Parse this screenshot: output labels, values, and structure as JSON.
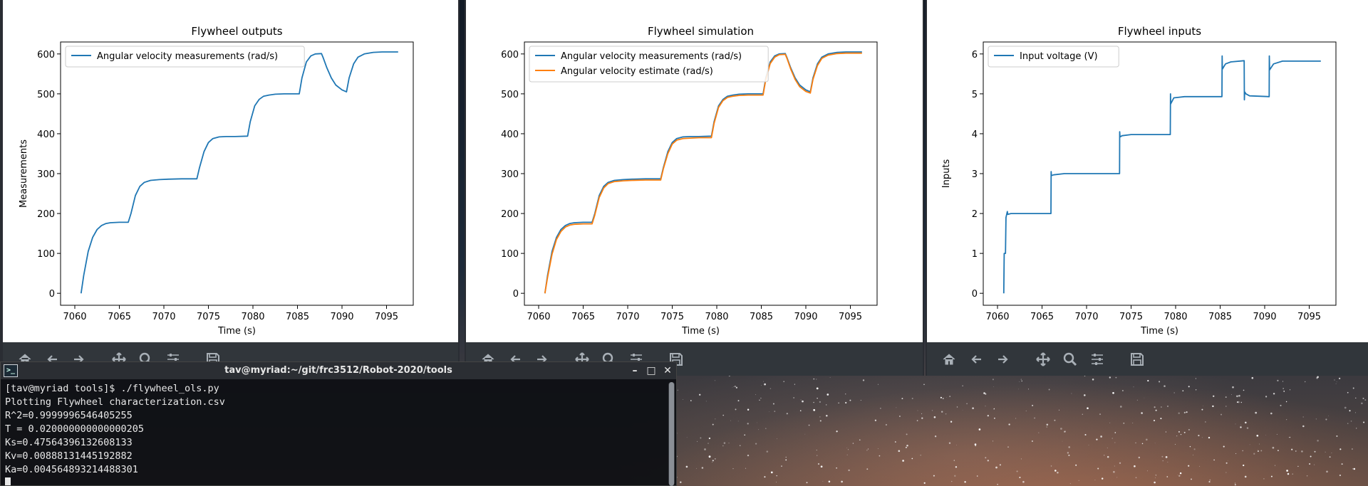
{
  "colors": {
    "series_blue": "#1f77b4",
    "series_orange": "#ff7f0e",
    "toolbar_bg": "#31363b",
    "toolbar_icon": "#a9b0b7",
    "terminal_text": "#e8e8e8"
  },
  "toolbar": {
    "icons": [
      "home-icon",
      "back-arrow-icon",
      "forward-arrow-icon",
      "pan-icon",
      "zoom-icon",
      "configure-subplots-icon",
      "save-icon"
    ]
  },
  "chart_data": [
    {
      "type": "line",
      "title": "Flywheel outputs",
      "xlabel": "Time (s)",
      "ylabel": "Measurements",
      "xlim": [
        7058.4,
        7098.0
      ],
      "ylim": [
        -30,
        630
      ],
      "xticks": [
        7060,
        7065,
        7070,
        7075,
        7080,
        7085,
        7090,
        7095
      ],
      "yticks": [
        0,
        100,
        200,
        300,
        400,
        500,
        600
      ],
      "legend": "top-left",
      "series": [
        {
          "name": "Angular velocity measurements (rad/s)",
          "color": "#1f77b4",
          "x": [
            7060.7,
            7061.0,
            7061.5,
            7062.0,
            7062.5,
            7063.0,
            7063.5,
            7064.0,
            7065.0,
            7066.0,
            7066.3,
            7066.8,
            7067.3,
            7067.8,
            7068.5,
            7069.5,
            7070.5,
            7072.0,
            7073.7,
            7074.0,
            7074.5,
            7075.0,
            7075.5,
            7076.2,
            7077.0,
            7078.0,
            7079.4,
            7079.7,
            7080.2,
            7080.7,
            7081.2,
            7081.8,
            7082.5,
            7083.5,
            7085.2,
            7085.5,
            7086.0,
            7086.5,
            7087.0,
            7087.7,
            7087.9,
            7088.3,
            7088.8,
            7089.3,
            7090.0,
            7090.5,
            7090.8,
            7091.3,
            7091.8,
            7092.5,
            7093.5,
            7094.5,
            7096.3
          ],
          "y": [
            0,
            45,
            105,
            140,
            160,
            170,
            175,
            177,
            178,
            178,
            200,
            245,
            268,
            278,
            283,
            285,
            286,
            287,
            287,
            315,
            355,
            378,
            388,
            392,
            393,
            393,
            394,
            430,
            470,
            486,
            494,
            497,
            499,
            500,
            500,
            540,
            580,
            595,
            600,
            601,
            590,
            565,
            540,
            522,
            510,
            505,
            540,
            575,
            592,
            600,
            604,
            605,
            605
          ]
        }
      ]
    },
    {
      "type": "line",
      "title": "Flywheel simulation",
      "xlabel": "Time (s)",
      "ylabel": "",
      "xlim": [
        7058.4,
        7098.0
      ],
      "ylim": [
        -30,
        630
      ],
      "xticks": [
        7060,
        7065,
        7070,
        7075,
        7080,
        7085,
        7090,
        7095
      ],
      "yticks": [
        0,
        100,
        200,
        300,
        400,
        500,
        600
      ],
      "legend": "top-left",
      "series": [
        {
          "name": "Angular velocity measurements (rad/s)",
          "color": "#1f77b4",
          "x": [
            7060.7,
            7061.0,
            7061.5,
            7062.0,
            7062.5,
            7063.0,
            7063.5,
            7064.0,
            7065.0,
            7066.0,
            7066.3,
            7066.8,
            7067.3,
            7067.8,
            7068.5,
            7069.5,
            7070.5,
            7072.0,
            7073.7,
            7074.0,
            7074.5,
            7075.0,
            7075.5,
            7076.2,
            7077.0,
            7078.0,
            7079.4,
            7079.7,
            7080.2,
            7080.7,
            7081.2,
            7081.8,
            7082.5,
            7083.5,
            7085.2,
            7085.5,
            7086.0,
            7086.5,
            7087.0,
            7087.7,
            7087.9,
            7088.3,
            7088.8,
            7089.3,
            7090.0,
            7090.5,
            7090.8,
            7091.3,
            7091.8,
            7092.5,
            7093.5,
            7094.5,
            7096.3
          ],
          "y": [
            0,
            45,
            105,
            140,
            160,
            170,
            175,
            177,
            178,
            178,
            200,
            245,
            268,
            278,
            283,
            285,
            286,
            287,
            287,
            315,
            355,
            378,
            388,
            392,
            393,
            393,
            394,
            430,
            470,
            486,
            494,
            497,
            499,
            500,
            500,
            540,
            580,
            595,
            600,
            601,
            590,
            565,
            540,
            522,
            510,
            505,
            540,
            575,
            592,
            600,
            604,
            605,
            605
          ]
        },
        {
          "name": "Angular velocity estimate (rad/s)",
          "color": "#ff7f0e",
          "x": [
            7060.7,
            7061.0,
            7061.5,
            7062.0,
            7062.5,
            7063.0,
            7063.5,
            7064.0,
            7065.0,
            7066.0,
            7066.3,
            7066.8,
            7067.3,
            7067.8,
            7068.5,
            7069.5,
            7070.5,
            7072.0,
            7073.7,
            7074.0,
            7074.5,
            7075.0,
            7075.5,
            7076.2,
            7077.0,
            7078.0,
            7079.4,
            7079.7,
            7080.2,
            7080.7,
            7081.2,
            7081.8,
            7082.5,
            7083.5,
            7085.2,
            7085.5,
            7086.0,
            7086.5,
            7087.0,
            7087.7,
            7087.9,
            7088.3,
            7088.8,
            7089.3,
            7090.0,
            7090.5,
            7090.8,
            7091.3,
            7091.8,
            7092.5,
            7093.5,
            7094.5,
            7096.3
          ],
          "y": [
            0,
            40,
            98,
            135,
            155,
            166,
            171,
            173,
            174,
            174,
            196,
            240,
            264,
            275,
            280,
            282,
            283,
            284,
            284,
            312,
            350,
            374,
            384,
            388,
            389,
            390,
            390,
            426,
            466,
            483,
            491,
            494,
            496,
            497,
            497,
            536,
            576,
            592,
            598,
            599,
            588,
            562,
            536,
            518,
            506,
            502,
            536,
            571,
            589,
            597,
            601,
            602,
            602
          ]
        }
      ]
    },
    {
      "type": "line",
      "title": "Flywheel inputs",
      "xlabel": "Time (s)",
      "ylabel": "Inputs",
      "xlim": [
        7058.4,
        7098.0
      ],
      "ylim": [
        -0.3,
        6.3
      ],
      "xticks": [
        7060,
        7065,
        7070,
        7075,
        7080,
        7085,
        7090,
        7095
      ],
      "yticks": [
        0,
        1,
        2,
        3,
        4,
        5,
        6
      ],
      "legend": "top-left",
      "series": [
        {
          "name": "Input voltage (V)",
          "color": "#1f77b4",
          "x": [
            7060.7,
            7060.75,
            7060.9,
            7060.95,
            7061.1,
            7061.15,
            7061.5,
            7066.0,
            7066.02,
            7066.05,
            7066.3,
            7067.5,
            7073.7,
            7073.72,
            7073.75,
            7074.0,
            7075.0,
            7079.4,
            7079.42,
            7079.45,
            7079.8,
            7081.0,
            7085.2,
            7085.22,
            7085.25,
            7085.6,
            7086.2,
            7087.7,
            7087.72,
            7087.75,
            7087.9,
            7088.3,
            7090.5,
            7090.52,
            7090.55,
            7091.0,
            7092.0,
            7096.3
          ],
          "y": [
            0,
            1.0,
            1.0,
            1.9,
            2.05,
            1.98,
            2.0,
            2.0,
            3.05,
            2.95,
            2.97,
            3.0,
            3.0,
            4.05,
            3.92,
            3.95,
            3.98,
            3.98,
            5.0,
            4.75,
            4.9,
            4.93,
            4.93,
            5.95,
            5.62,
            5.75,
            5.8,
            5.83,
            4.85,
            5.05,
            5.0,
            4.95,
            4.93,
            5.95,
            5.6,
            5.75,
            5.82,
            5.82
          ]
        }
      ]
    }
  ],
  "terminal": {
    "title": "tav@myriad:~/git/frc3512/Robot-2020/tools",
    "icon_label": ">_",
    "lines": [
      "[tav@myriad tools]$ ./flywheel_ols.py",
      "Plotting Flywheel characterization.csv",
      "R^2=0.9999996546405255",
      "T = 0.020000000000000205",
      "Ks=0.47564396132608133",
      "Kv=0.00888131445192882",
      "Ka=0.004564893214488301"
    ],
    "minimize_glyph": "–",
    "maximize_glyph": "□",
    "close_glyph": "✕"
  }
}
